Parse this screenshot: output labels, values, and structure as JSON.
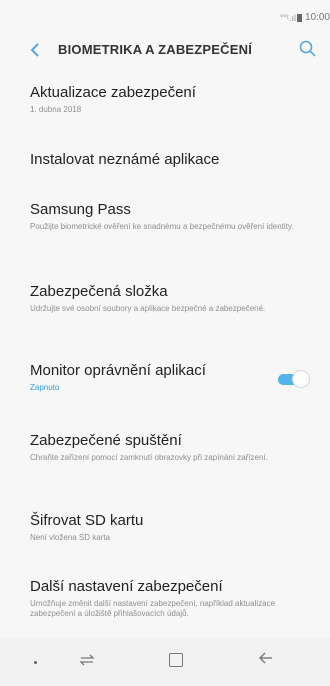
{
  "status": {
    "signal": "°°ᵗ.ıl",
    "time": "10:00"
  },
  "header": {
    "back_icon": "chevron-left",
    "title": "BIOMETRIKA A ZABEZPEČENÍ",
    "search_icon": "search"
  },
  "settings": {
    "items": [
      {
        "title": "Aktualizace zabezpečení",
        "subtitle": "1. dubna 2018"
      },
      {
        "title": "Instalovat neznámé aplikace",
        "subtitle": ""
      },
      {
        "title": "Samsung Pass",
        "subtitle": "Použijte biometrické ověření ke snadnému a bezpečnému ověření identity."
      },
      {
        "title": "Zabezpečená složka",
        "subtitle": "Udržujte své osobní soubory a aplikace bezpečné a zabezpečené."
      },
      {
        "title": "Monitor oprávnění aplikací",
        "status": "Zapnuto",
        "toggle_on": true
      },
      {
        "title": "Zabezpečené spuštění",
        "subtitle": "Chraňte zařízení pomocí zamknutí obrazovky při zapínání zařízení."
      },
      {
        "title": "Šifrovat SD kartu",
        "subtitle": "Není vložena SD karta"
      },
      {
        "title": "Další nastavení zabezpečení",
        "subtitle": "Umožňuje změnit další nastavení zabezpečení, například aktualizace zabezpečení a úložiště přihlašovacích údajů."
      }
    ]
  },
  "navbar": {
    "dot_icon": "dot",
    "recent_icon": "recent-apps",
    "home_icon": "home",
    "back_icon": "back-arrow"
  },
  "colors": {
    "accent": "#53b4e8",
    "background": "#f7f7f7"
  }
}
